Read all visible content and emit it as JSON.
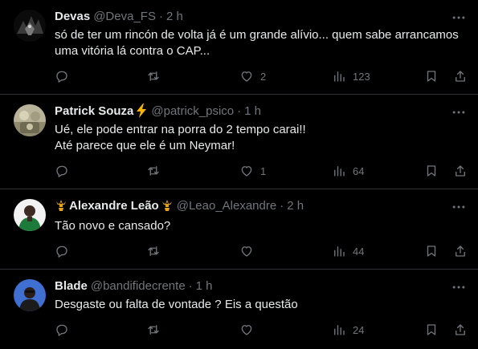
{
  "tweets": [
    {
      "name": "Devas",
      "handle": "@Deva_FS",
      "time": "2 h",
      "lines": [
        "só de ter um rincón de volta já é um grande alívio... quem sabe arrancamos",
        "uma vitória lá contra o CAP..."
      ],
      "likes": "2",
      "views": "123"
    },
    {
      "name": "Patrick Souza",
      "handle": "@patrick_psico",
      "time": "1 h",
      "lines": [
        "Ué, ele pode entrar na porra do 2 tempo carai!!",
        "Até parece que ele é um Neymar!"
      ],
      "likes": "1",
      "views": "64"
    },
    {
      "name": "Alexandre Leão",
      "handle": "@Leao_Alexandre",
      "time": "2 h",
      "lines": [
        "Tão novo e cansado?"
      ],
      "likes": "",
      "views": "44"
    },
    {
      "name": "Blade",
      "handle": "@bandifidecrente",
      "time": "1 h",
      "lines": [
        "Desgaste ou falta de vontade ? Eis a questão"
      ],
      "likes": "",
      "views": "24"
    }
  ],
  "separator": "·",
  "icons": {
    "more": "more-icon",
    "reply": "reply-icon",
    "retweet": "retweet-icon",
    "like": "like-icon",
    "views": "views-icon",
    "bookmark": "bookmark-icon",
    "share": "share-icon",
    "lightning": "lightning-emoji",
    "trident": "trident-emoji"
  },
  "colors": {
    "background": "#000000",
    "text": "#e7e9ea",
    "muted": "#71767b",
    "divider": "#2f3336",
    "lightning": "#f5b400",
    "trident": "#e8a317"
  }
}
